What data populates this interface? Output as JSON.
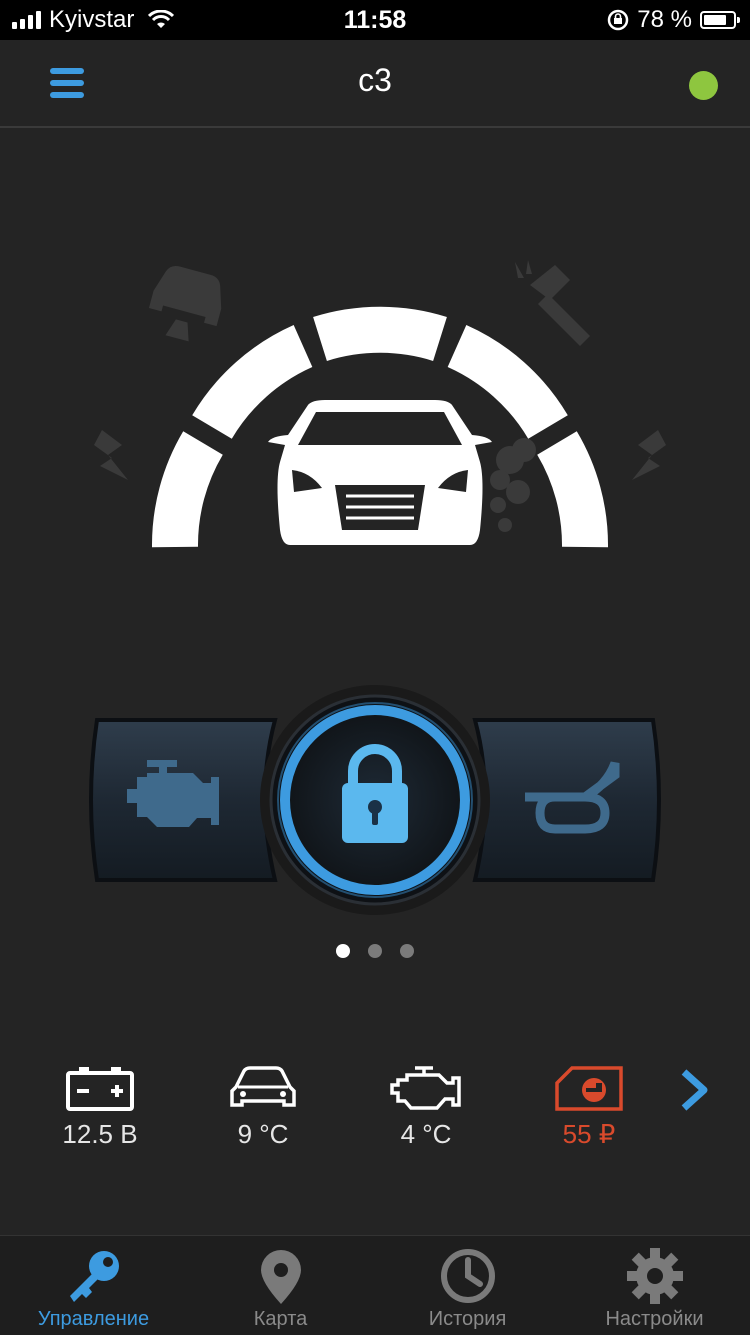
{
  "status_bar": {
    "carrier": "Kyivstar",
    "time": "11:58",
    "battery_percent": "78 %",
    "battery_level": 0.78
  },
  "header": {
    "title": "c3",
    "connection_status_color": "#8ec63f"
  },
  "gauge": {
    "icons": [
      "car-tilt-icon",
      "hammer-icon",
      "shock-left-icon",
      "shock-right-icon",
      "smoke-icon",
      "car-front-icon"
    ]
  },
  "controls": {
    "left": "engine-icon",
    "center": "lock-icon",
    "right": "horn-icon"
  },
  "pager": {
    "pages": 3,
    "active": 0
  },
  "stats": [
    {
      "icon": "battery-icon",
      "value": "12.5 В"
    },
    {
      "icon": "car-temp-icon",
      "value": "9 °C"
    },
    {
      "icon": "engine-temp-icon",
      "value": "4 °C"
    },
    {
      "icon": "balance-icon",
      "value": "55 ₽"
    }
  ],
  "tabs": [
    {
      "icon": "key-icon",
      "label": "Управление",
      "active": true
    },
    {
      "icon": "map-pin-icon",
      "label": "Карта",
      "active": false
    },
    {
      "icon": "clock-icon",
      "label": "История",
      "active": false
    },
    {
      "icon": "gear-icon",
      "label": "Настройки",
      "active": false
    }
  ],
  "colors": {
    "accent": "#3d9be0",
    "background": "#242424",
    "warning": "#d94a2c"
  }
}
